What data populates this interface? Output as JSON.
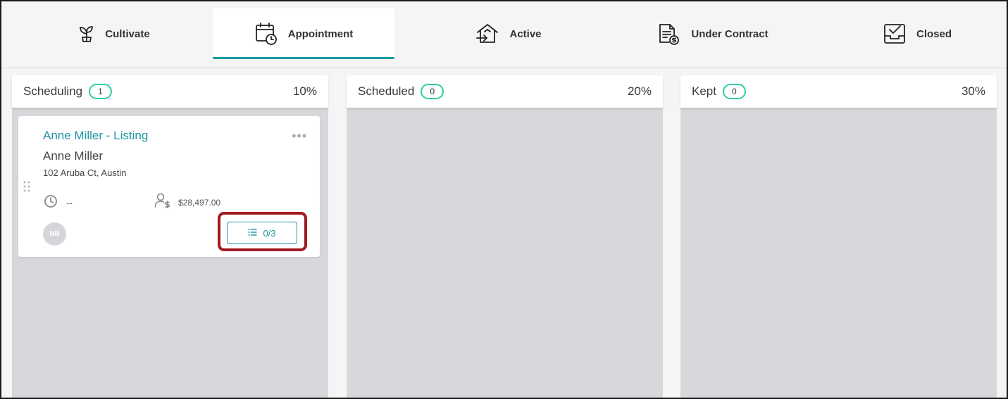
{
  "tabs": [
    {
      "label": "Cultivate",
      "icon": "sprout-icon"
    },
    {
      "label": "Appointment",
      "icon": "calendar-clock-icon",
      "active": true
    },
    {
      "label": "Active",
      "icon": "house-arrow-icon"
    },
    {
      "label": "Under Contract",
      "icon": "document-dollar-icon"
    },
    {
      "label": "Closed",
      "icon": "inbox-check-icon"
    }
  ],
  "columns": [
    {
      "title": "Scheduling",
      "count": "1",
      "percent": "10%"
    },
    {
      "title": "Scheduled",
      "count": "0",
      "percent": "20%"
    },
    {
      "title": "Kept",
      "count": "0",
      "percent": "30%"
    }
  ],
  "card": {
    "title": "Anne Miller - Listing",
    "more": "•••",
    "name": "Anne Miller",
    "address": "102 Aruba Ct, Austin",
    "time": "--",
    "amount": "$28,497.00",
    "avatar_initials": "NB",
    "tasks": "0/3"
  },
  "colors": {
    "accent": "#1f95a3",
    "count_border": "#2bcfa7",
    "highlight": "#a31a1e",
    "column_bg": "#d7d8dc"
  }
}
